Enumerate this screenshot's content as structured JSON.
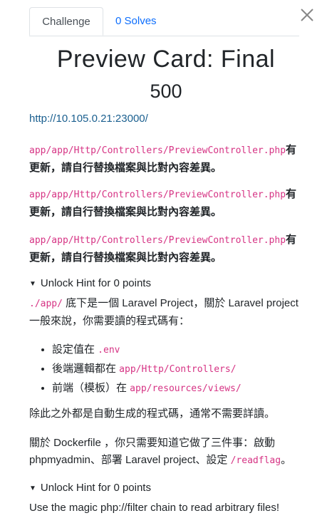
{
  "tabs": {
    "challenge": "Challenge",
    "solves": "0 Solves"
  },
  "close_icon": "close-icon",
  "challenge": {
    "name": "Preview Card: Final",
    "value": "500",
    "url": "http://10.105.0.21:23000/"
  },
  "notices": [
    {
      "path": "app/app/Http/Controllers/PreviewController.php",
      "text_a": "有",
      "text_b": "更新，請自行替換檔案與比對內容差異。"
    },
    {
      "path": "app/app/Http/Controllers/PreviewController.php",
      "text_a": "有",
      "text_b": "更新，請自行替換檔案與比對內容差異。"
    },
    {
      "path": "app/app/Http/Controllers/PreviewController.php",
      "text_a": "有",
      "text_b": "更新，請自行替換檔案與比對內容差異。"
    }
  ],
  "hint1": {
    "title": "Unlock Hint for 0 points",
    "intro_code": "./app/",
    "intro_a": " 底下是一個 Laravel Project，關於 Laravel project",
    "intro_b": "一般來說，你需要讀的程式碼有：",
    "items": [
      {
        "text": "設定值在 ",
        "code": ".env"
      },
      {
        "text": "後端邏輯都在 ",
        "code": "app/Http/Controllers/"
      },
      {
        "text": "前端（模板）在 ",
        "code": "app/resources/views/"
      }
    ],
    "para2": "除此之外都是自動生成的程式碼，通常不需要詳讀。",
    "para3_a": "關於 Dockerfile ，你只需要知道它做了三件事：啟動",
    "para3_b": "phpmyadmin、部署 Laravel project、設定 ",
    "para3_code": "/readflag",
    "para3_end": "。"
  },
  "hint2": {
    "title": "Unlock Hint for 0 points",
    "text": "Use the magic php://filter chain to read arbitrary files!"
  }
}
